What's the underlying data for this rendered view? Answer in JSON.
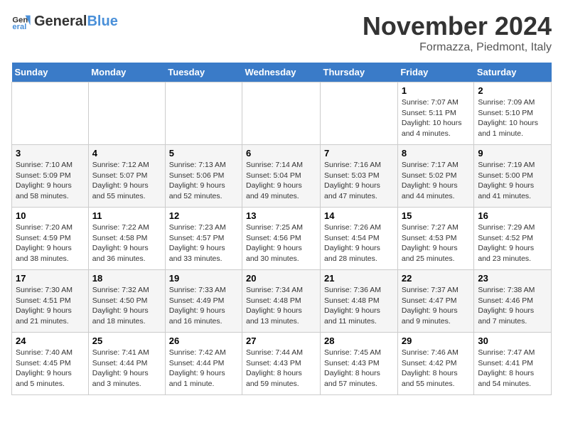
{
  "logo": {
    "general": "General",
    "blue": "Blue"
  },
  "title": "November 2024",
  "location": "Formazza, Piedmont, Italy",
  "days_of_week": [
    "Sunday",
    "Monday",
    "Tuesday",
    "Wednesday",
    "Thursday",
    "Friday",
    "Saturday"
  ],
  "weeks": [
    [
      {
        "day": "",
        "info": ""
      },
      {
        "day": "",
        "info": ""
      },
      {
        "day": "",
        "info": ""
      },
      {
        "day": "",
        "info": ""
      },
      {
        "day": "",
        "info": ""
      },
      {
        "day": "1",
        "info": "Sunrise: 7:07 AM\nSunset: 5:11 PM\nDaylight: 10 hours and 4 minutes."
      },
      {
        "day": "2",
        "info": "Sunrise: 7:09 AM\nSunset: 5:10 PM\nDaylight: 10 hours and 1 minute."
      }
    ],
    [
      {
        "day": "3",
        "info": "Sunrise: 7:10 AM\nSunset: 5:09 PM\nDaylight: 9 hours and 58 minutes."
      },
      {
        "day": "4",
        "info": "Sunrise: 7:12 AM\nSunset: 5:07 PM\nDaylight: 9 hours and 55 minutes."
      },
      {
        "day": "5",
        "info": "Sunrise: 7:13 AM\nSunset: 5:06 PM\nDaylight: 9 hours and 52 minutes."
      },
      {
        "day": "6",
        "info": "Sunrise: 7:14 AM\nSunset: 5:04 PM\nDaylight: 9 hours and 49 minutes."
      },
      {
        "day": "7",
        "info": "Sunrise: 7:16 AM\nSunset: 5:03 PM\nDaylight: 9 hours and 47 minutes."
      },
      {
        "day": "8",
        "info": "Sunrise: 7:17 AM\nSunset: 5:02 PM\nDaylight: 9 hours and 44 minutes."
      },
      {
        "day": "9",
        "info": "Sunrise: 7:19 AM\nSunset: 5:00 PM\nDaylight: 9 hours and 41 minutes."
      }
    ],
    [
      {
        "day": "10",
        "info": "Sunrise: 7:20 AM\nSunset: 4:59 PM\nDaylight: 9 hours and 38 minutes."
      },
      {
        "day": "11",
        "info": "Sunrise: 7:22 AM\nSunset: 4:58 PM\nDaylight: 9 hours and 36 minutes."
      },
      {
        "day": "12",
        "info": "Sunrise: 7:23 AM\nSunset: 4:57 PM\nDaylight: 9 hours and 33 minutes."
      },
      {
        "day": "13",
        "info": "Sunrise: 7:25 AM\nSunset: 4:56 PM\nDaylight: 9 hours and 30 minutes."
      },
      {
        "day": "14",
        "info": "Sunrise: 7:26 AM\nSunset: 4:54 PM\nDaylight: 9 hours and 28 minutes."
      },
      {
        "day": "15",
        "info": "Sunrise: 7:27 AM\nSunset: 4:53 PM\nDaylight: 9 hours and 25 minutes."
      },
      {
        "day": "16",
        "info": "Sunrise: 7:29 AM\nSunset: 4:52 PM\nDaylight: 9 hours and 23 minutes."
      }
    ],
    [
      {
        "day": "17",
        "info": "Sunrise: 7:30 AM\nSunset: 4:51 PM\nDaylight: 9 hours and 21 minutes."
      },
      {
        "day": "18",
        "info": "Sunrise: 7:32 AM\nSunset: 4:50 PM\nDaylight: 9 hours and 18 minutes."
      },
      {
        "day": "19",
        "info": "Sunrise: 7:33 AM\nSunset: 4:49 PM\nDaylight: 9 hours and 16 minutes."
      },
      {
        "day": "20",
        "info": "Sunrise: 7:34 AM\nSunset: 4:48 PM\nDaylight: 9 hours and 13 minutes."
      },
      {
        "day": "21",
        "info": "Sunrise: 7:36 AM\nSunset: 4:48 PM\nDaylight: 9 hours and 11 minutes."
      },
      {
        "day": "22",
        "info": "Sunrise: 7:37 AM\nSunset: 4:47 PM\nDaylight: 9 hours and 9 minutes."
      },
      {
        "day": "23",
        "info": "Sunrise: 7:38 AM\nSunset: 4:46 PM\nDaylight: 9 hours and 7 minutes."
      }
    ],
    [
      {
        "day": "24",
        "info": "Sunrise: 7:40 AM\nSunset: 4:45 PM\nDaylight: 9 hours and 5 minutes."
      },
      {
        "day": "25",
        "info": "Sunrise: 7:41 AM\nSunset: 4:44 PM\nDaylight: 9 hours and 3 minutes."
      },
      {
        "day": "26",
        "info": "Sunrise: 7:42 AM\nSunset: 4:44 PM\nDaylight: 9 hours and 1 minute."
      },
      {
        "day": "27",
        "info": "Sunrise: 7:44 AM\nSunset: 4:43 PM\nDaylight: 8 hours and 59 minutes."
      },
      {
        "day": "28",
        "info": "Sunrise: 7:45 AM\nSunset: 4:43 PM\nDaylight: 8 hours and 57 minutes."
      },
      {
        "day": "29",
        "info": "Sunrise: 7:46 AM\nSunset: 4:42 PM\nDaylight: 8 hours and 55 minutes."
      },
      {
        "day": "30",
        "info": "Sunrise: 7:47 AM\nSunset: 4:41 PM\nDaylight: 8 hours and 54 minutes."
      }
    ]
  ]
}
